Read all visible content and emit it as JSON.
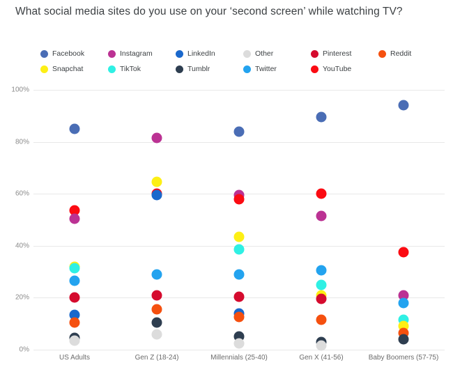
{
  "chart_data": {
    "type": "scatter",
    "title": "What social media sites do you use on your ‘second screen’ while watching TV?",
    "xlabel": "",
    "ylabel": "",
    "ylim": [
      0,
      100
    ],
    "ytick_labels": [
      "0%",
      "20%",
      "40%",
      "60%",
      "80%",
      "100%"
    ],
    "ytick_values": [
      0,
      20,
      40,
      60,
      80,
      100
    ],
    "grid": true,
    "legend_position": "top",
    "categories": [
      "US Adults",
      "Gen Z (18-24)",
      "Millennials (25-40)",
      "Gen X (41-56)",
      "Baby Boomers (57-75)"
    ],
    "series": [
      {
        "name": "Facebook",
        "color": "#4a6db5",
        "values": [
          85,
          null,
          84,
          89.5,
          94
        ]
      },
      {
        "name": "Instagram",
        "color": "#bb3293",
        "values": [
          50.5,
          81.5,
          59.5,
          51.5,
          21
        ]
      },
      {
        "name": "LinkedIn",
        "color": "#1a68cc",
        "values": [
          13.5,
          59.5,
          14,
          null,
          null
        ]
      },
      {
        "name": "Other",
        "color": "#dcdcdc",
        "values": [
          3.5,
          6,
          2.5,
          1.5,
          null
        ]
      },
      {
        "name": "Pinterest",
        "color": "#d50b2e",
        "values": [
          20,
          21,
          20.5,
          19.5,
          null
        ]
      },
      {
        "name": "Reddit",
        "color": "#f5500f",
        "values": [
          10.5,
          15.5,
          12.5,
          11.5,
          6.5
        ]
      },
      {
        "name": "Snapchat",
        "color": "#fdef15",
        "values": [
          32,
          64.5,
          43.5,
          21,
          9
        ]
      },
      {
        "name": "TikTok",
        "color": "#2ff0e4",
        "values": [
          31.5,
          null,
          38.5,
          25,
          11.5
        ]
      },
      {
        "name": "Tumblr",
        "color": "#2e3e50",
        "values": [
          4.5,
          10.5,
          5,
          3,
          4
        ]
      },
      {
        "name": "Twitter",
        "color": "#23a3ef",
        "values": [
          26.5,
          29,
          29,
          30.5,
          18
        ]
      },
      {
        "name": "YouTube",
        "color": "#fb0b12",
        "values": [
          53.5,
          60,
          58,
          60,
          37.5
        ]
      }
    ]
  }
}
